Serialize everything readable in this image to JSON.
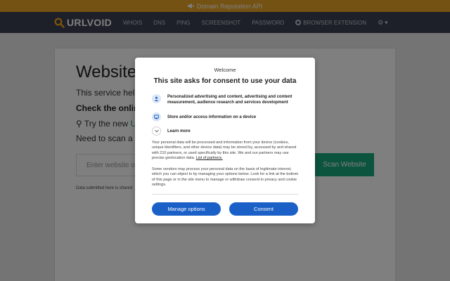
{
  "banner": {
    "text": "Domain Reputation API",
    "icon": "megaphone-icon"
  },
  "navbar": {
    "logo": "URLVOID",
    "items": [
      {
        "label": "WHOIS"
      },
      {
        "label": "DNS"
      },
      {
        "label": "PING"
      },
      {
        "label": "SCREENSHOT"
      },
      {
        "label": "PASSWORD"
      },
      {
        "label": "BROWSER EXTENSION"
      }
    ],
    "settings_icon": "gear-icon"
  },
  "main": {
    "title": "Website",
    "text": "This service help",
    "bold": "Check the onlin",
    "try_prefix": "Try the new ",
    "try_link": "U",
    "need": "Need to scan a",
    "input_placeholder": "Enter website o",
    "scan_button": "Scan Website",
    "note": "Data submitted here is shared"
  },
  "dialog": {
    "welcome": "Welcome",
    "title": "This site asks for consent to use your data",
    "purposes": [
      {
        "text": "Personalized advertising and content, advertising and content measurement, audience research and services development",
        "icon": "person-icon"
      },
      {
        "text": "Store and/or access information on a device",
        "icon": "device-icon"
      },
      {
        "text": "Learn more",
        "icon": "chevron-down-icon"
      }
    ],
    "body1": "Your personal data will be processed and information from your device (cookies, unique identifiers, and other device data) may be stored by, accessed by and shared with 210 partners, or used specifically by this site. We and our partners may use precise geolocation data. ",
    "body1_link": "List of partners.",
    "body2": "Some vendors may process your personal data on the basis of legitimate interest, which you can object to by managing your options below. Look for a link at the bottom of this page or in the site menu to manage or withdraw consent in privacy and cookie settings.",
    "manage_button": "Manage options",
    "consent_button": "Consent"
  },
  "colors": {
    "banner": "#e8a526",
    "navbar": "#3a4151",
    "accent": "#1aa87e",
    "button": "#1a60c7"
  }
}
